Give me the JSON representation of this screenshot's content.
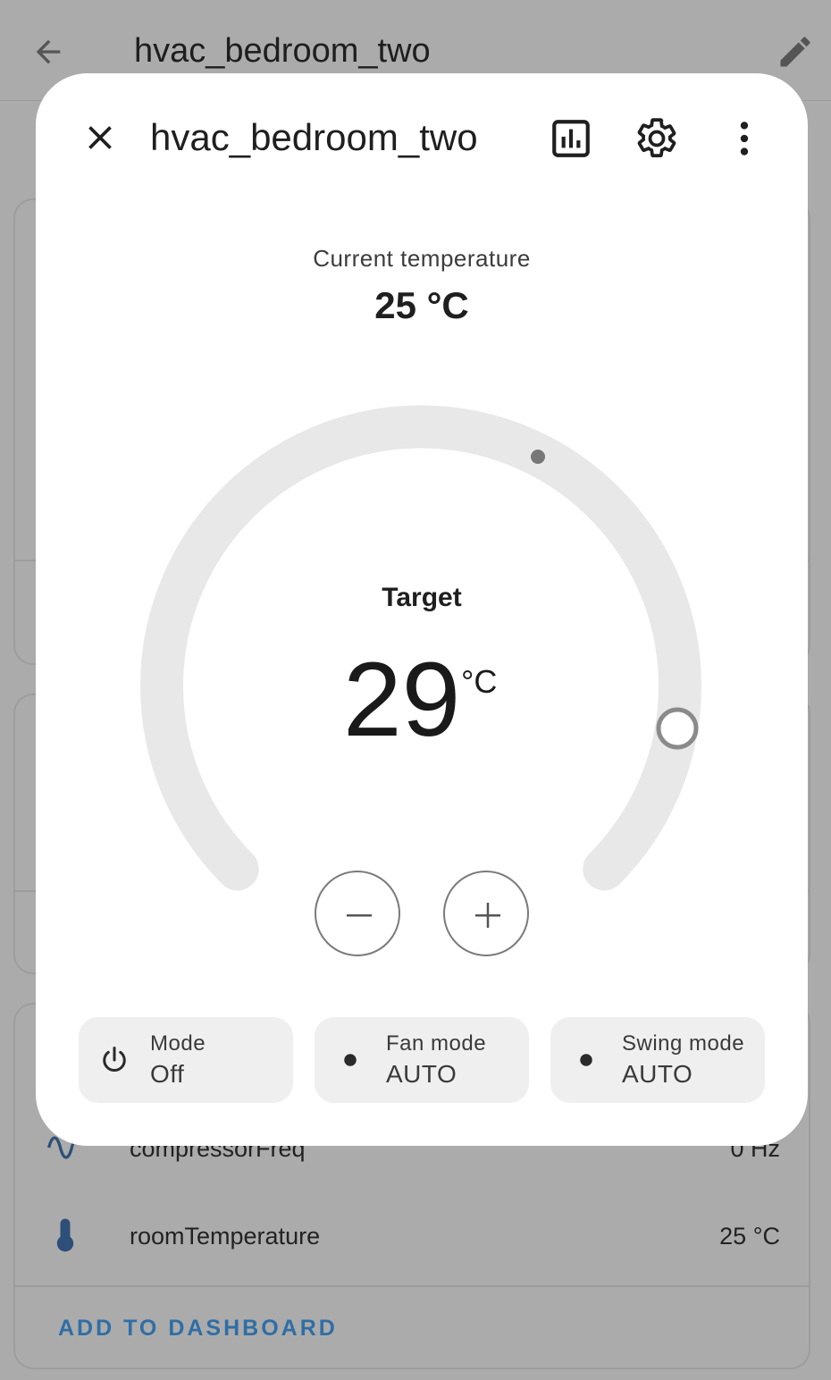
{
  "background": {
    "title": "hvac_bedroom_two",
    "rows": [
      {
        "name": "compressorFreq",
        "value": "0 Hz"
      },
      {
        "name": "roomTemperature",
        "value": "25 °C"
      }
    ],
    "add_to_dashboard": "ADD TO DASHBOARD"
  },
  "dialog": {
    "title": "hvac_bedroom_two",
    "current_label": "Current temperature",
    "current_value": "25 °C",
    "target_label": "Target",
    "target_value": "29",
    "target_unit": "°C",
    "modes": [
      {
        "label": "Mode",
        "value": "Off",
        "icon": "power-icon"
      },
      {
        "label": "Fan mode",
        "value": "AUTO",
        "icon": "dot-icon"
      },
      {
        "label": "Swing mode",
        "value": "AUTO",
        "icon": "dot-icon"
      }
    ]
  },
  "colors": {
    "scrim": "#ababab",
    "dialog_bg": "#ffffff",
    "dial_track": "#e8e8e8",
    "chip_bg": "#efefef",
    "link": "#2f6ea5"
  }
}
